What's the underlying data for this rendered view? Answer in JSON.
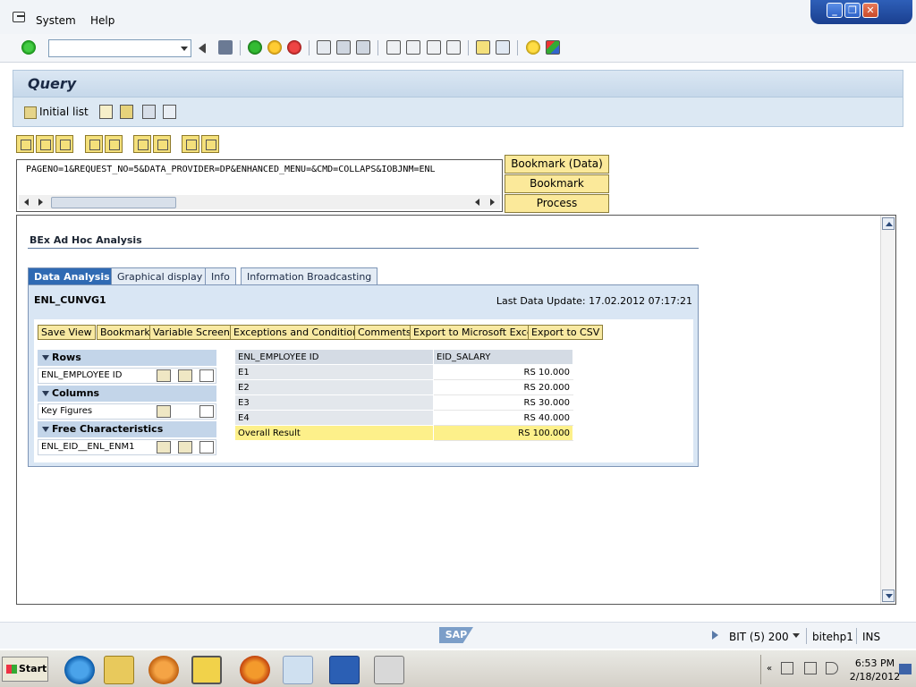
{
  "menubar": {
    "items": [
      "System",
      "Help"
    ]
  },
  "title": "Query",
  "apptoolbar": {
    "initial_list": "Initial list"
  },
  "url_text": "PAGENO=1&REQUEST_NO=5&DATA_PROVIDER=DP&ENHANCED_MENU=&CMD=COLLAPS&IOBJNM=ENL",
  "side_buttons": [
    "Bookmark (Data)",
    "Bookmark",
    "Process"
  ],
  "bex": {
    "title": "BEx Ad Hoc Analysis",
    "tabs": [
      "Data Analysis",
      "Graphical display",
      "Info",
      "Information Broadcasting"
    ],
    "query_name": "ENL_CUNVG1",
    "last_update": "Last Data Update: 17.02.2012 07:17:21",
    "actions": [
      "Save View",
      "Bookmark",
      "Variable Screen",
      "Exceptions and Conditions",
      "Comments",
      "Export to Microsoft Excel",
      "Export to CSV"
    ],
    "nav": {
      "rows_label": "Rows",
      "rows_item": "ENL_EMPLOYEE ID",
      "columns_label": "Columns",
      "columns_item": "Key Figures",
      "free_label": "Free Characteristics",
      "free_item": "ENL_EID__ENL_ENM1"
    },
    "table": {
      "headers": [
        "ENL_EMPLOYEE ID",
        "EID_SALARY"
      ],
      "rows": [
        [
          "E1",
          "RS 10.000"
        ],
        [
          "E2",
          "RS 20.000"
        ],
        [
          "E3",
          "RS 30.000"
        ],
        [
          "E4",
          "RS 40.000"
        ]
      ],
      "total": [
        "Overall Result",
        "RS 100.000"
      ]
    }
  },
  "statusbar": {
    "system": "BIT (5) 200",
    "host": "bitehp1",
    "mode": "INS",
    "logo": "SAP"
  },
  "taskbar": {
    "start": "Start",
    "time": "6:53 PM",
    "date": "2/18/2012"
  }
}
